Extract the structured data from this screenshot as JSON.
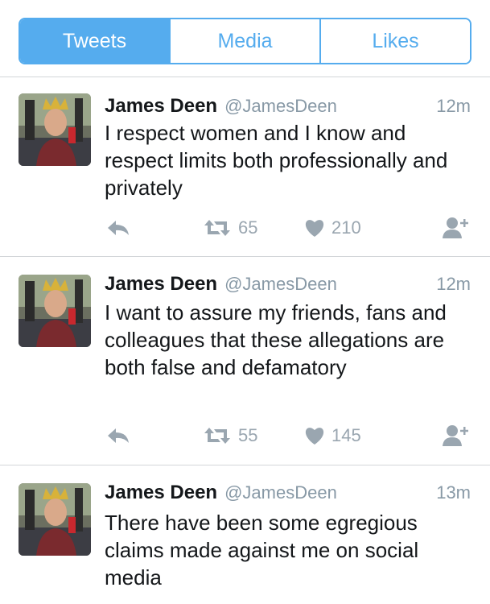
{
  "tabs": [
    {
      "label": "Tweets",
      "active": true
    },
    {
      "label": "Media",
      "active": false
    },
    {
      "label": "Likes",
      "active": false
    }
  ],
  "tweets": [
    {
      "name": "James Deen",
      "handle": "@JamesDeen",
      "time": "12m",
      "text": "I respect women and I know and respect limits both professionally and privately",
      "retweets": "65",
      "likes": "210"
    },
    {
      "name": "James Deen",
      "handle": "@JamesDeen",
      "time": "12m",
      "text": "I want to assure my friends, fans and colleagues that these allegations are both false and defamatory",
      "retweets": "55",
      "likes": "145"
    },
    {
      "name": "James Deen",
      "handle": "@JamesDeen",
      "time": "13m",
      "text": "There have been some egregious claims made against me on social media"
    }
  ],
  "colors": {
    "accent": "#55acee",
    "muted": "#8899a6",
    "icon": "#9aa6b0"
  },
  "icons": {
    "reply": "reply-icon",
    "retweet": "retweet-icon",
    "like": "heart-icon",
    "follow": "follow-user-icon"
  }
}
